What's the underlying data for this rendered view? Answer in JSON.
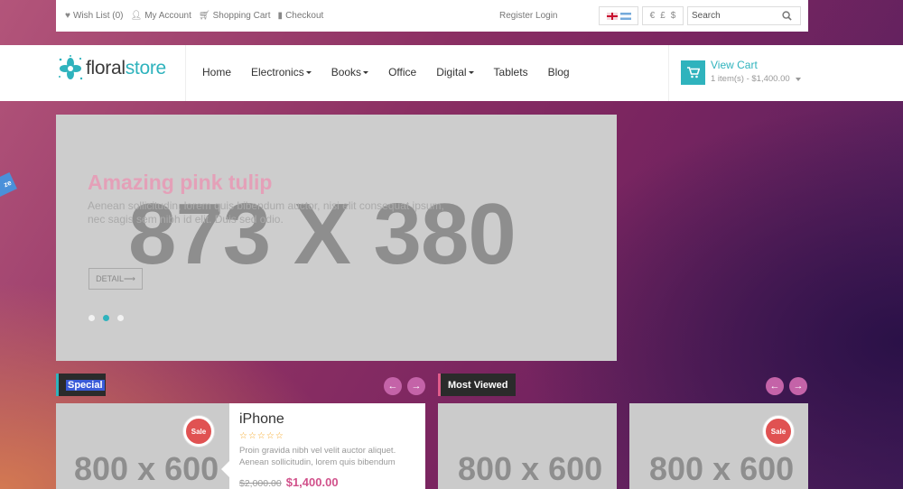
{
  "topbar": {
    "wishlist": "Wish List (0)",
    "account": "My Account",
    "cart": "Shopping Cart",
    "checkout": "Checkout",
    "register_login": "Register Login",
    "currencies": [
      "€",
      "£",
      "$"
    ],
    "search_placeholder": "Search"
  },
  "header": {
    "logo_part1": "floral",
    "logo_part2": "store",
    "nav": [
      {
        "label": "Home",
        "dropdown": false
      },
      {
        "label": "Electronics",
        "dropdown": true
      },
      {
        "label": "Books",
        "dropdown": true
      },
      {
        "label": "Office",
        "dropdown": false
      },
      {
        "label": "Digital",
        "dropdown": true
      },
      {
        "label": "Tablets",
        "dropdown": false
      },
      {
        "label": "Blog",
        "dropdown": false
      }
    ],
    "view_cart": "View Cart",
    "cart_summary": "1 item(s) - $1,400.00"
  },
  "slider": {
    "placeholder": "873 X 380",
    "title": "Amazing pink tulip",
    "description": "Aenean sollicitudin, lorem quis bibendum auctor, nisi elit consequat ipsum, nec sagis sem nibh id elit. Duis sed odio.",
    "button": "DETAIL",
    "slides": 3,
    "active_slide": 2
  },
  "sidetab_label": "ze",
  "special": {
    "title": "Special",
    "product": {
      "image_placeholder": "800 x 600",
      "badge": "Sale",
      "name": "iPhone",
      "rating": "☆☆☆☆☆",
      "description": "Proin gravida nibh vel velit auctor aliquet. Aenean sollicitudin, lorem quis bibendum",
      "old_price": "$2,000.00",
      "price": "$1,400.00"
    }
  },
  "most_viewed": {
    "title": "Most Viewed",
    "products": [
      {
        "image_placeholder": "800 x 600",
        "badge": ""
      },
      {
        "image_placeholder": "800 x 600",
        "badge": "Sale"
      }
    ]
  },
  "arrows": {
    "prev": "←",
    "next": "→"
  },
  "colors": {
    "accent": "#2fb3bd",
    "pink": "#d1518b",
    "sale": "#e05252",
    "arrow": "#c463a8"
  }
}
